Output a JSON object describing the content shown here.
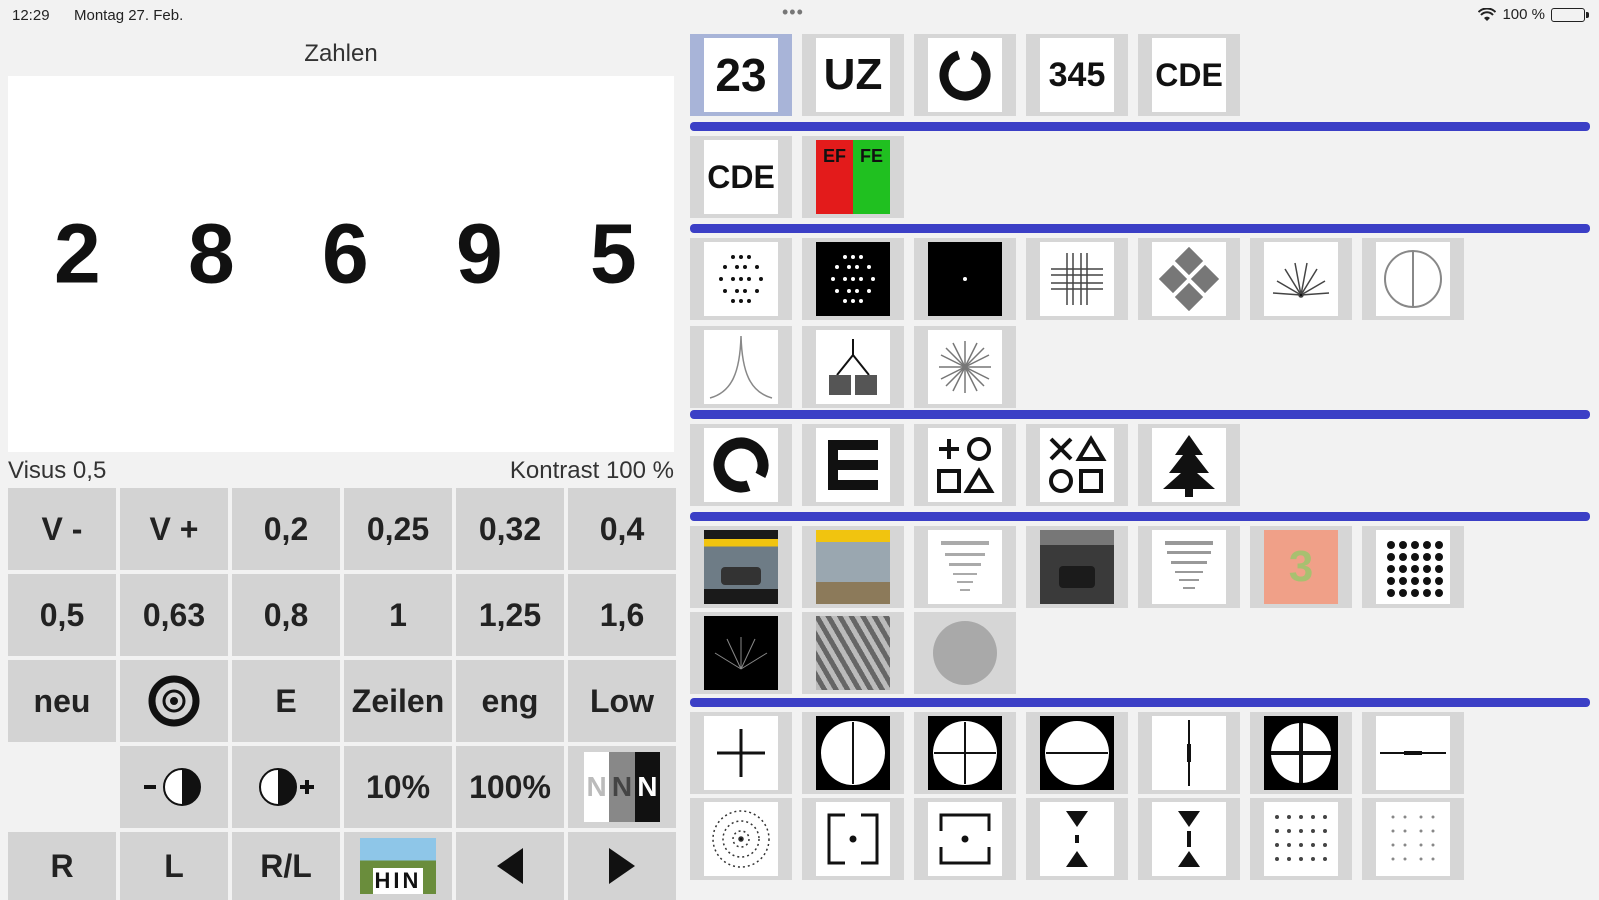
{
  "status": {
    "time": "12:29",
    "date": "Montag 27. Feb.",
    "battery": "100 %"
  },
  "panel": {
    "title": "Zahlen",
    "optotypes": [
      "2",
      "8",
      "6",
      "9",
      "5"
    ],
    "visus_label": "Visus  0,5",
    "kontrast_label": "Kontrast   100 %"
  },
  "keypad": {
    "row1": [
      "V -",
      "V +",
      "0,2",
      "0,25",
      "0,32",
      "0,4"
    ],
    "row2": [
      "0,5",
      "0,63",
      "0,8",
      "1",
      "1,25",
      "1,6"
    ],
    "row3": [
      "neu",
      "",
      "E",
      "Zeilen",
      "eng",
      "Low"
    ],
    "row4": [
      "",
      "",
      "",
      "10%",
      "100%",
      ""
    ],
    "row5": [
      "R",
      "L",
      "R/L",
      "",
      "",
      ""
    ],
    "low_n": "N"
  },
  "tests": {
    "row1": [
      "23",
      "UZ",
      "",
      "345",
      "CDE"
    ],
    "row2": [
      "CDE",
      ""
    ],
    "red_green": {
      "red": "EF",
      "green": "FE"
    }
  },
  "colors": {
    "accent": "#3b3fc6",
    "button": "#d3d3d3",
    "selected": "#a8b4d8"
  }
}
